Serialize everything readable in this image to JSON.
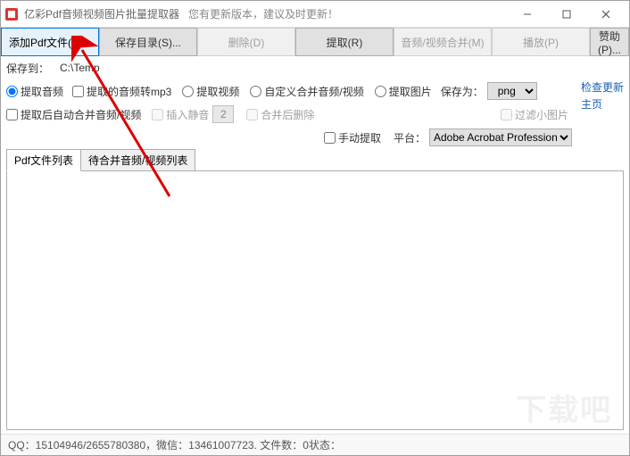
{
  "titlebar": {
    "app_name": "亿彩Pdf音频视频图片批量提取器",
    "update_hint": "您有更新版本，建议及时更新！"
  },
  "toolbar": {
    "add_pdf": "添加Pdf文件(A)...",
    "save_dir": "保存目录(S)...",
    "delete": "删除(D)",
    "extract": "提取(R)",
    "merge_av": "音频/视频合并(M)",
    "play": "播放(P)",
    "sponsor": "赞助(P)..."
  },
  "row1": {
    "save_to_label": "保存到：",
    "save_to_value": "C:\\Temp"
  },
  "row2": {
    "extract_audio": "提取音频",
    "audio_to_mp3": "提取的音频转mp3",
    "extract_video": "提取视频",
    "custom_merge": "自定义合并音频/视频",
    "extract_image": "提取图片",
    "save_as_label": "保存为：",
    "save_as_value": "png"
  },
  "row3": {
    "auto_merge": "提取后自动合并音频/视频",
    "insert_silence": "插入静音",
    "silence_value": "2",
    "delete_after_merge": "合并后删除",
    "filter_small_img": "过滤小图片"
  },
  "row4": {
    "manual_extract": "手动提取",
    "platform_label": "平台：",
    "platform_value": "Adobe Acrobat Profession"
  },
  "links": {
    "check_update": "检查更新",
    "home": "主页"
  },
  "tabs": {
    "pdf_list": "Pdf文件列表",
    "merge_list": "待合并音频/视频列表"
  },
  "status": {
    "qq_label": "QQ：",
    "qq_value": "15104946/2655780380",
    "wechat_label": "，微信：",
    "wechat_value": "13461007723",
    "file_count_label": ". 文件数：",
    "file_count_value": "0",
    "state_label": " 状态："
  }
}
